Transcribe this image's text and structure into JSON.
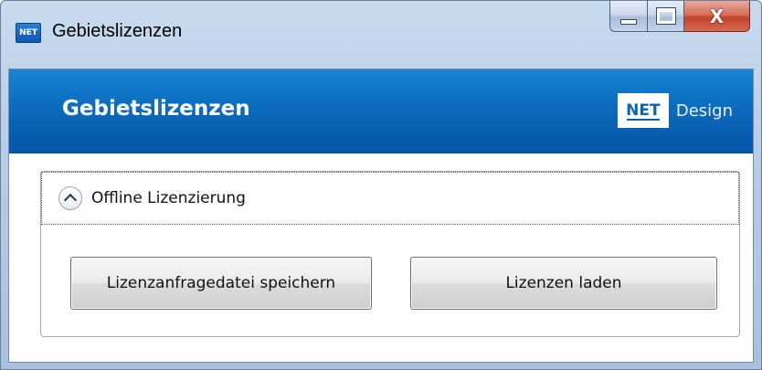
{
  "window": {
    "title": "Gebietslizenzen",
    "app_icon_text": "NET",
    "close_glyph": "X"
  },
  "banner": {
    "title": "Gebietslizenzen",
    "logo_box": "NET",
    "logo_text": "Design"
  },
  "expander": {
    "label": "Offline Lizenzierung",
    "state": "expanded"
  },
  "buttons": {
    "save_request": "Lizenzanfragedatei speichern",
    "load_licenses": "Lizenzen laden"
  },
  "colors": {
    "banner_blue": "#0a64b6",
    "close_red": "#c2412b"
  }
}
